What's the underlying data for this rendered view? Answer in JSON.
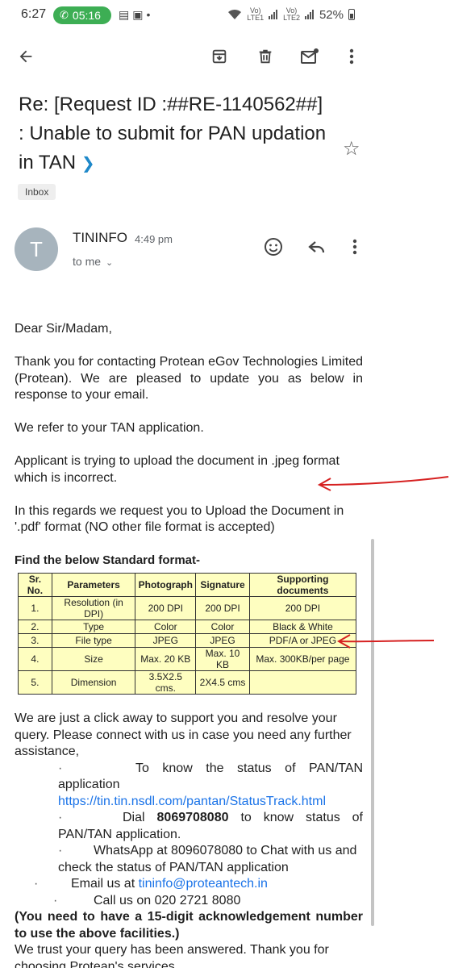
{
  "status_bar": {
    "time": "6:27",
    "call_timer": "05:16",
    "signal_1": "Vo)\nLTE1",
    "signal_2": "Vo)\nLTE2",
    "battery": "52%"
  },
  "toolbar": {
    "icons": [
      "back-arrow-icon",
      "archive-icon",
      "delete-icon",
      "mark-unread-icon",
      "more-vert-icon"
    ]
  },
  "email": {
    "subject": "Re: [Request ID :##RE-1140562##] : Unable to submit for PAN updation in TAN",
    "label": "Inbox",
    "sender_initial": "T",
    "sender_name": "TININFO",
    "sent_time": "4:49 pm",
    "recipient": "to me",
    "body": {
      "greeting": "Dear Sir/Madam,",
      "para1": "Thank you for contacting Protean eGov Technologies Limited (Protean). We are pleased to update you as below in response to your email.",
      "para2": "We refer to your TAN application.",
      "para3": "Applicant is trying to upload the document in .jpeg format which is incorrect.",
      "para4": "In this regards we request you to Upload the Document in '.pdf' format (NO other file format is accepted)",
      "table_title": "Find the below Standard format-",
      "table_headers": [
        "Sr. No.",
        "Parameters",
        "Photograph",
        "Signature",
        "Supporting documents"
      ],
      "table_rows": [
        [
          "1.",
          "Resolution (in DPI)",
          "200 DPI",
          "200 DPI",
          "200 DPI"
        ],
        [
          "2.",
          "Type",
          "Color",
          "Color",
          "Black & White"
        ],
        [
          "3.",
          "File type",
          "JPEG",
          "JPEG",
          "PDF/A or JPEG"
        ],
        [
          "4.",
          "Size",
          "Max. 20 KB",
          "Max. 10 KB",
          "Max. 300KB/per page"
        ],
        [
          "5.",
          "Dimension",
          "3.5X2.5 cms.",
          "2X4.5 cms",
          ""
        ]
      ],
      "para5": "We are just a click away to support you and resolve your query. Please connect with us in case you need any further assistance,",
      "bullet1_text": "To know the status of PAN/TAN application",
      "bullet1_link": "https://tin.tin.nsdl.com/pantan/StatusTrack.html",
      "bullet2_pre": "Dial",
      "bullet2_number": "8069708080",
      "bullet2_post": "to know status of PAN/TAN application.",
      "bullet3": "WhatsApp at 8096078080 to Chat with us and check the status of PAN/TAN application",
      "bullet4_pre": "Email us at",
      "bullet4_email": "tininfo@proteantech.in",
      "bullet5": "Call us on 020 2721 8080",
      "note": "(You need to have a 15-digit acknowledgement number to use the above facilities.)",
      "closing": "We trust your query has been answered. Thank you for choosing Protean's services."
    }
  },
  "colors": {
    "call_pill": "#3dae54",
    "link": "#1a73e8",
    "table_bg": "#fefec0",
    "annotation": "#d62020",
    "avatar": "#a7b4bd"
  }
}
